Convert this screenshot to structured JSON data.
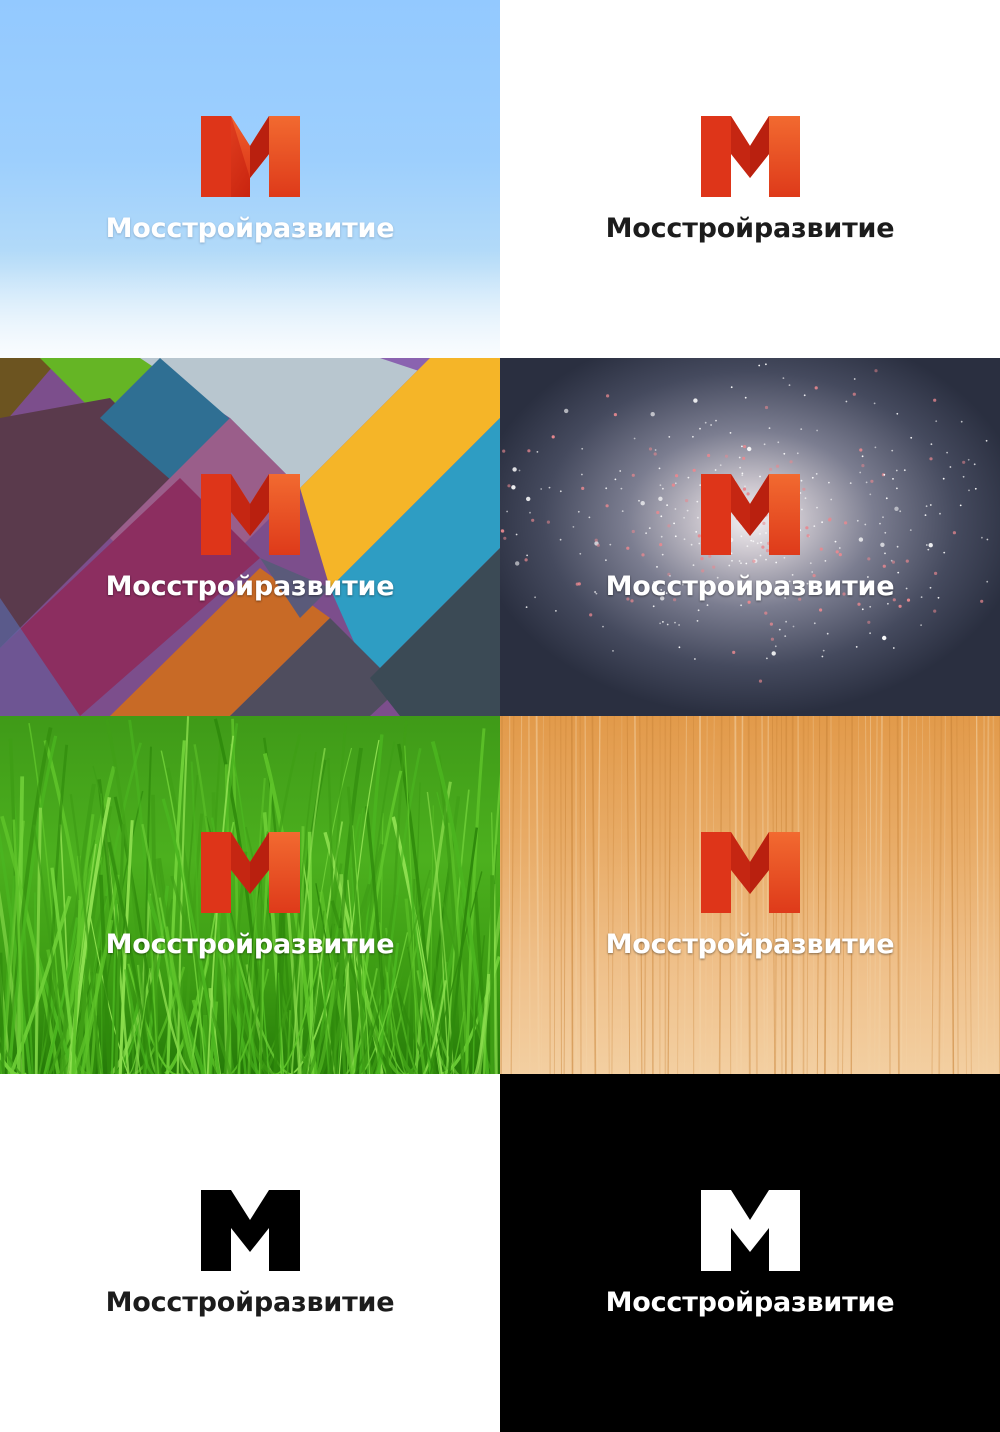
{
  "brand": {
    "wordmark": "Мосстройразвитие"
  },
  "colors": {
    "logo_red": "#e2321f",
    "logo_red_light": "#ee5a2c",
    "logo_red_dark": "#b81e12",
    "mono_dark": "#000000",
    "mono_light": "#ffffff",
    "sky": "#93c9ff",
    "black_panel": "#000000"
  },
  "panels": [
    {
      "background": "sky-gradient",
      "logo": "red-m-logo",
      "text_tone": "light"
    },
    {
      "background": "white",
      "logo": "red-m-logo",
      "text_tone": "dark"
    },
    {
      "background": "geometric-diagonal-pattern",
      "logo": "red-m-logo",
      "text_tone": "light"
    },
    {
      "background": "spiral-galaxy-photo",
      "logo": "red-m-logo",
      "text_tone": "light"
    },
    {
      "background": "green-grass-photo",
      "logo": "red-m-logo",
      "text_tone": "light"
    },
    {
      "background": "wood-grain-texture",
      "logo": "red-m-logo",
      "text_tone": "light"
    },
    {
      "background": "white",
      "logo": "black-m-logo",
      "text_tone": "dark"
    },
    {
      "background": "black",
      "logo": "white-m-logo",
      "text_tone": "light"
    }
  ]
}
